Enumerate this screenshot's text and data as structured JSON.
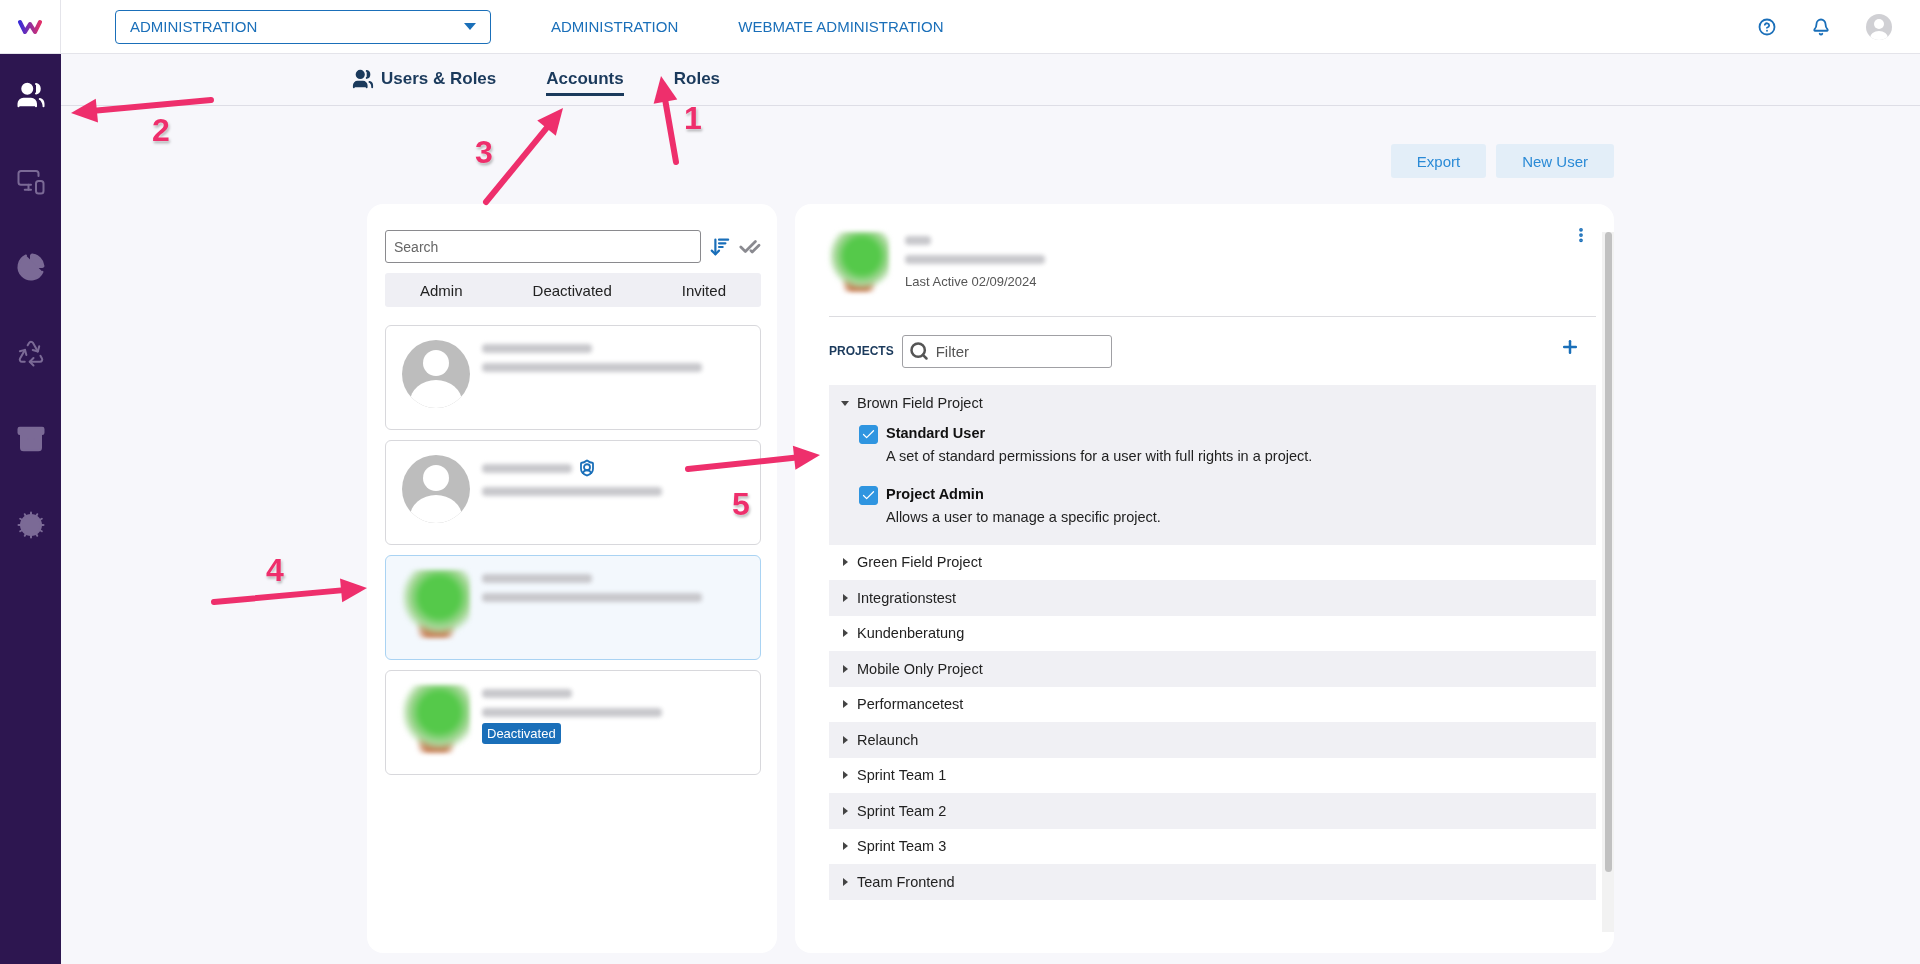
{
  "top_bar": {
    "workspace_select": "ADMINISTRATION",
    "nav_links": [
      "ADMINISTRATION",
      "WEBMATE ADMINISTRATION"
    ]
  },
  "sidebar": {
    "items": [
      {
        "kind": "users",
        "selected": true
      },
      {
        "kind": "devices",
        "selected": false
      },
      {
        "kind": "chart",
        "selected": false
      },
      {
        "kind": "integrations",
        "selected": false
      },
      {
        "kind": "archive",
        "selected": false
      },
      {
        "kind": "settings",
        "selected": false
      }
    ]
  },
  "tabs": [
    {
      "label": "Users & Roles",
      "kind": "section",
      "selected": false
    },
    {
      "label": "Accounts",
      "kind": "tab",
      "selected": true
    },
    {
      "label": "Roles",
      "kind": "tab",
      "selected": false
    }
  ],
  "buttons": [
    "Export",
    "New User"
  ],
  "user_list": {
    "search": {
      "placeholder": "Search"
    },
    "filters": [
      "Admin",
      "Deactivated",
      "Invited"
    ],
    "users": [
      {
        "kind": "silhouette",
        "admin": false,
        "selected": false
      },
      {
        "kind": "silhouette",
        "admin": true,
        "selected": false
      },
      {
        "kind": "photo",
        "admin": false,
        "selected": true
      },
      {
        "kind": "photo",
        "admin": false,
        "selected": false,
        "badge": "Deactivated"
      }
    ]
  },
  "user_detail": {
    "last_active": "Last Active 02/09/2024",
    "projects_label": "PROJECTS",
    "filter": {
      "placeholder": "Filter"
    },
    "projects": [
      {
        "name": "Brown Field Project",
        "expanded": true,
        "roles": [
          {
            "name": "Standard User",
            "description": "A set of standard permissions for a user with full rights in a project.",
            "checked": true
          },
          {
            "name": "Project Admin",
            "description": "Allows a user to manage a specific project.",
            "checked": true
          }
        ]
      },
      {
        "name": "Green Field Project",
        "expanded": false
      },
      {
        "name": "Integrationstest",
        "expanded": false
      },
      {
        "name": "Kundenberatung",
        "expanded": false
      },
      {
        "name": "Mobile Only Project",
        "expanded": false
      },
      {
        "name": "Performancetest",
        "expanded": false
      },
      {
        "name": "Relaunch",
        "expanded": false
      },
      {
        "name": "Sprint Team 1",
        "expanded": false
      },
      {
        "name": "Sprint Team 2",
        "expanded": false
      },
      {
        "name": "Sprint Team 3",
        "expanded": false
      },
      {
        "name": "Team Frontend",
        "expanded": false
      }
    ]
  },
  "annotations": [
    "1",
    "2",
    "3",
    "4",
    "5"
  ]
}
